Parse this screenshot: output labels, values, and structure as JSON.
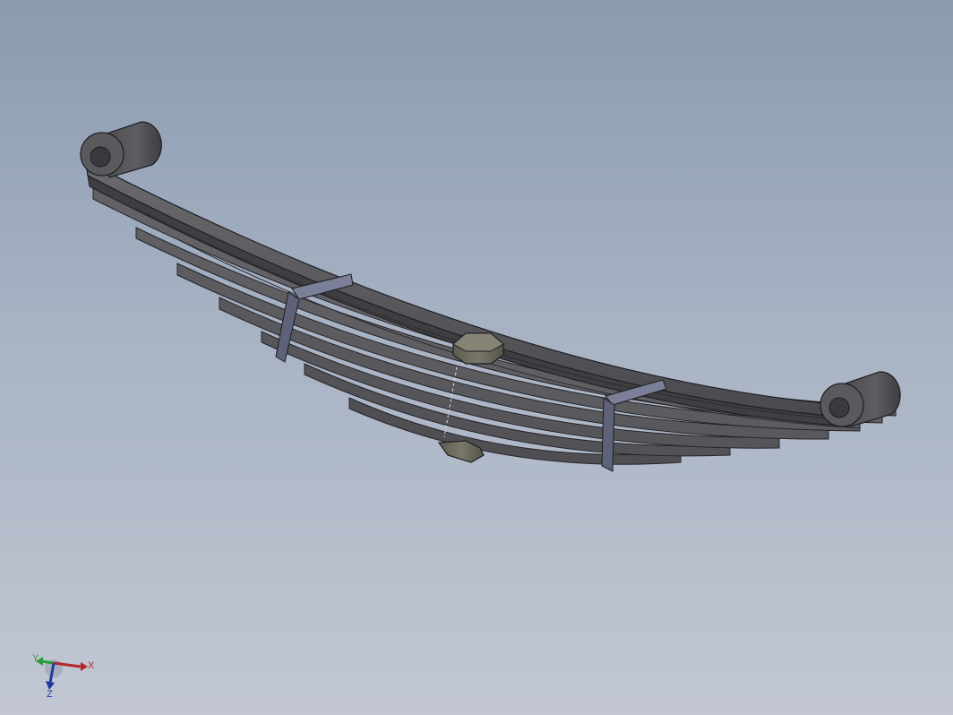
{
  "scene": {
    "model": "leaf-spring",
    "colors": {
      "background_top": "#8a9bb0",
      "background_bottom": "#c2c7d3",
      "leaf": "#5b5b5f",
      "leaf_edge": "#2a2a2e",
      "clamp": "#6c7188",
      "bolt": "#6f6d5e"
    }
  },
  "triad": {
    "x_label": "X",
    "y_label": "Y",
    "z_label": "Z",
    "colors": {
      "x": "#b3262b",
      "y": "#2c9a3a",
      "z": "#1f3a9e"
    }
  }
}
